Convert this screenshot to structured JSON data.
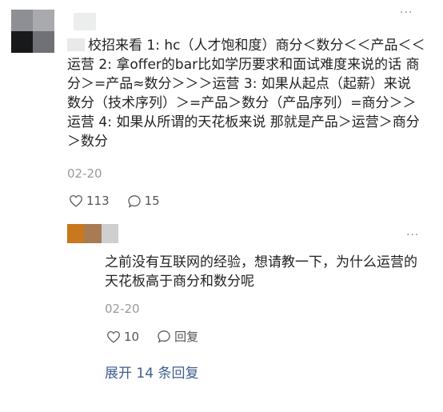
{
  "comment": {
    "text": "校招来看 1: hc（人才饱和度）商分＜数分＜＜产品＜＜运营 2: 拿offer的bar比如学历要求和面试难度来说的话 商分＞=产品≈数分＞＞＞运营 3: 如果从起点（起薪）来说 数分（技术序列）＞=产品＞数分（产品序列）=商分＞＞运营 4: 如果从所谓的天花板来说 那就是产品＞运营＞商分＞数分",
    "date": "02-20",
    "likes": "113",
    "replies": "15",
    "more": "···"
  },
  "reply": {
    "text": "之前没有互联网的经验，想请教一下，为什么运营的天花板高于商分和数分呢",
    "date": "02-20",
    "likes": "10",
    "reply_label": "回复",
    "more": "···"
  },
  "expand_label": "展开 14 条回复",
  "icons": [
    "heart-icon",
    "comment-bubble-icon",
    "more-icon"
  ]
}
